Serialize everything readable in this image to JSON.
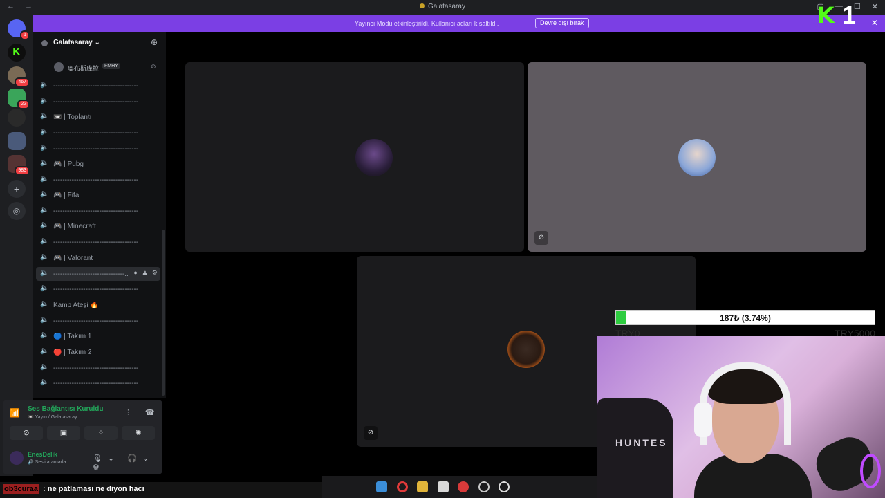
{
  "window": {
    "nav": "← →",
    "title": "Galatasaray",
    "controls": [
      "▢",
      "—",
      "☐",
      "✕"
    ]
  },
  "kick_badge": {
    "logo": "K",
    "count": "1"
  },
  "banner": {
    "message": "Yayıncı Modu etkinleştirildi. Kullanıcı adları kısaltıldı.",
    "button": "Devre dışı bırak",
    "close": "✕"
  },
  "servers": [
    {
      "name": "discord-home",
      "badge": "1",
      "color": "#5865f2"
    },
    {
      "name": "kick",
      "badge": "",
      "color": "#53fc18"
    },
    {
      "name": "server-2",
      "badge": "467",
      "color": "#7a6a55"
    },
    {
      "name": "server-3",
      "badge": "22",
      "color": "#3aa55a"
    },
    {
      "name": "server-4",
      "badge": "",
      "color": "#2a2a2a"
    },
    {
      "name": "server-5",
      "badge": "",
      "color": "#4a5a7a"
    },
    {
      "name": "server-6",
      "badge": "983",
      "color": "#553333"
    }
  ],
  "sidebar": {
    "guild_name": "Galatasaray",
    "member": {
      "name": "奥布斯库拉",
      "tag": "FMHY"
    },
    "channels": [
      {
        "label": "-------------------------------------",
        "selected": false
      },
      {
        "label": "-------------------------------------",
        "selected": false
      },
      {
        "label": "📼 | Toplantı",
        "selected": false
      },
      {
        "label": "-------------------------------------",
        "selected": false
      },
      {
        "label": "-------------------------------------",
        "selected": false
      },
      {
        "label": "🎮 | Pubg",
        "selected": false
      },
      {
        "label": "-------------------------------------",
        "selected": false
      },
      {
        "label": "🎮 | Fifa",
        "selected": false
      },
      {
        "label": "-------------------------------------",
        "selected": false
      },
      {
        "label": "🎮 | Minecraft",
        "selected": false
      },
      {
        "label": "-------------------------------------",
        "selected": false
      },
      {
        "label": "🎮 | Valorant",
        "selected": false
      },
      {
        "label": "-------------------------------...",
        "selected": true
      },
      {
        "label": "-------------------------------------",
        "selected": false
      },
      {
        "label": "Kamp Ateşi 🔥",
        "selected": false
      },
      {
        "label": "-------------------------------------",
        "selected": false
      },
      {
        "label": "🔵 | Takım 1",
        "selected": false
      },
      {
        "label": "🔴 | Takım 2",
        "selected": false
      },
      {
        "label": "-------------------------------------",
        "selected": false
      },
      {
        "label": "-------------------------------------",
        "selected": false
      }
    ]
  },
  "voice_panel": {
    "status": "Ses Bağlantısı Kuruldu",
    "channel": "📼 Yayın / Galatasaray",
    "user_name": "EnesDelik",
    "user_status": "🔊 Sesli aramada"
  },
  "donation": {
    "text": "187₺ (3.74%)",
    "percent": 3.74,
    "left_label": "TRY0",
    "right_label": "TRY5000"
  },
  "webcam": {
    "chair_brand": "HUNTES"
  },
  "chat": {
    "user": "ob3curaa",
    "message": ": ne patlaması ne diyon hacı"
  },
  "colors": {
    "accent": "#5865f2",
    "banner": "#7b3fe4",
    "green": "#23a55a",
    "kick": "#53fc18"
  }
}
